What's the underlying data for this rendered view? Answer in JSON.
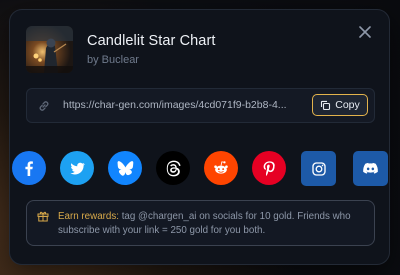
{
  "dialog": {
    "title": "Candlelit Star Chart",
    "byline": "by Buclear",
    "close_icon": "close-icon"
  },
  "share": {
    "url": "https://char-gen.com/images/4cd071f9-b2b8-4...",
    "copy_label": "Copy"
  },
  "social": {
    "items": [
      {
        "name": "facebook",
        "color": "#1877f2"
      },
      {
        "name": "twitter",
        "color": "#1da1f2"
      },
      {
        "name": "bluesky",
        "color": "#1185fe"
      },
      {
        "name": "threads",
        "color": "#000000"
      },
      {
        "name": "reddit",
        "color": "#ff4500"
      },
      {
        "name": "pinterest",
        "color": "#e60023"
      },
      {
        "name": "instagram",
        "color": "#1d5aa8"
      },
      {
        "name": "discord",
        "color": "#1d5aa8"
      }
    ]
  },
  "rewards": {
    "title": "Earn rewards:",
    "body": " tag @chargen_ai on socials for 10 gold. Friends who subscribe with your link = 250 gold for you both."
  },
  "colors": {
    "accent": "#e3b34c",
    "background": "#0f131b"
  }
}
